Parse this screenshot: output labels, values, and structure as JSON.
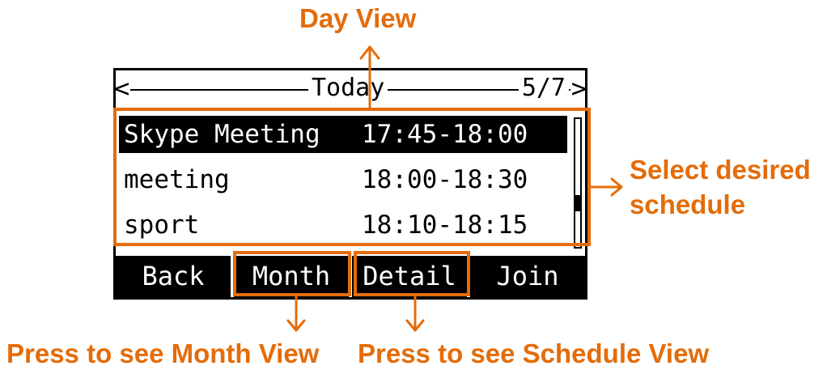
{
  "callouts": {
    "day_view": "Day View",
    "select_line1": "Select desired",
    "select_line2": "schedule",
    "month_view": "Press to see Month View",
    "schedule_view": "Press to see Schedule View"
  },
  "screen": {
    "title": "Today",
    "page": "5/7",
    "left_chevron": "<",
    "right_chevron": ">",
    "schedules": [
      {
        "name": "Skype Meeting",
        "time": "17:45-18:00",
        "selected": true
      },
      {
        "name": "meeting",
        "time": "18:00-18:30",
        "selected": false
      },
      {
        "name": "sport",
        "time": "18:10-18:15",
        "selected": false
      }
    ],
    "softkeys": [
      "Back",
      "Month",
      "Detail",
      "Join"
    ]
  },
  "colors": {
    "accent": "#E46C0A",
    "screen_fg": "#000000",
    "screen_bg": "#ffffff"
  }
}
